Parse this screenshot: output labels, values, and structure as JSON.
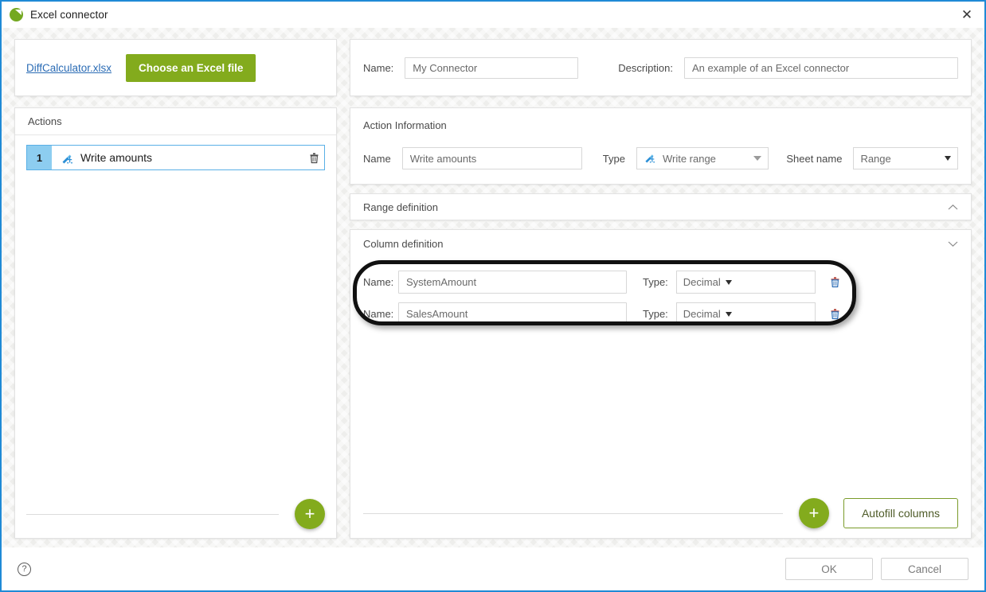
{
  "window": {
    "title": "Excel connector",
    "logo_icon": "excel-connector-logo-icon",
    "close_icon": "close-icon",
    "border_color": "#1f8ad6"
  },
  "file_bar": {
    "file_name": "DiffCalculator.xlsx",
    "choose_button": "Choose an Excel file",
    "choose_button_color": "#83ab1d"
  },
  "meta": {
    "name_label": "Name:",
    "name_value": "My Connector",
    "description_label": "Description:",
    "description_value": "An example of an Excel connector"
  },
  "actions_panel": {
    "header": "Actions",
    "add_icon": "plus-icon",
    "items": [
      {
        "number": "1",
        "label": "Write amounts",
        "icon": "write-range-icon",
        "delete_icon": "trash-icon",
        "badge_color": "#8dcdf0",
        "selected": true
      }
    ]
  },
  "action_information": {
    "title": "Action Information",
    "name_label": "Name",
    "name_value": "Write amounts",
    "type_label": "Type",
    "type_value": "Write range",
    "type_icon": "write-range-icon",
    "type_caret_icon": "caret-down-icon",
    "sheet_label": "Sheet name",
    "sheet_value": "Range",
    "sheet_caret_icon": "caret-down-icon"
  },
  "range_definition": {
    "title": "Range definition",
    "chevron_icon": "chevron-up-icon",
    "chevron_glyph": "⌃",
    "expanded": false
  },
  "column_definition": {
    "title": "Column definition",
    "chevron_icon": "chevron-down-icon",
    "chevron_glyph": "⌄",
    "expanded": true,
    "name_label": "Name:",
    "type_label": "Type:",
    "rows": [
      {
        "name": "SystemAmount",
        "type": "Decimal",
        "delete_icon": "trash-icon",
        "caret_icon": "caret-down-icon"
      },
      {
        "name": "SalesAmount",
        "type": "Decimal",
        "delete_icon": "trash-icon",
        "caret_icon": "caret-down-icon"
      }
    ],
    "add_icon": "plus-icon",
    "autofill_button": "Autofill columns",
    "annotation": {
      "shape": "hand-drawn-rounded-rectangle",
      "color": "#111111"
    }
  },
  "footer": {
    "help_icon": "help-icon",
    "help_glyph": "?",
    "ok_label": "OK",
    "cancel_label": "Cancel"
  },
  "glyphs": {
    "plus": "+",
    "close": "✕"
  }
}
